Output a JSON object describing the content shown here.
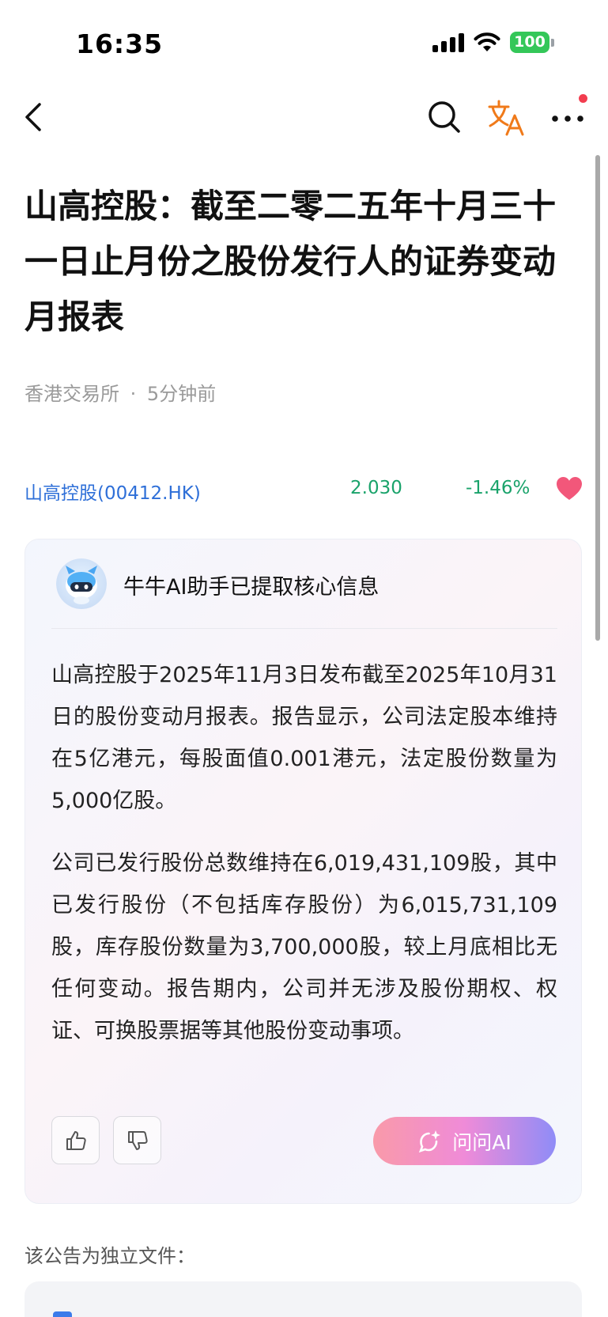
{
  "status_bar": {
    "time": "16:35",
    "battery": "100",
    "icons": [
      "signal-icon",
      "wifi-icon",
      "battery-icon"
    ]
  },
  "nav": {
    "icons": [
      "back-arrow-icon",
      "search-icon",
      "translate-icon",
      "more-icon"
    ],
    "accent_color": "#f07a1a",
    "notification_dot_color": "#f23d4f"
  },
  "article": {
    "title": "山高控股：截至二零二五年十月三十一日止月份之股份发行人的证券变动月报表",
    "source": "香港交易所",
    "separator": "·",
    "time_ago": "5分钟前"
  },
  "stock": {
    "name": "山高控股(00412.HK)",
    "price": "2.030",
    "change": "-1.46%",
    "price_color": "#1aa36b",
    "link_color": "#2e6fd8",
    "favorited": true
  },
  "ai_summary": {
    "header": "牛牛AI助手已提取核心信息",
    "paragraphs": [
      "山高控股于2025年11月3日发布截至2025年10月31日的股份变动月报表。报告显示，公司法定股本维持在5亿港元，每股面值0.001港元，法定股份数量为5,000亿股。",
      "公司已发行股份总数维持在6,019,431,109股，其中已发行股份（不包括库存股份）为6,015,731,109股，库存股份数量为3,700,000股，较上月底相比无任何变动。报告期内，公司并无涉及股份期权、权证、可换股票据等其他股份变动事项。"
    ],
    "ask_button": "问问AI"
  },
  "attachment": {
    "label": "该公告为独立文件："
  }
}
